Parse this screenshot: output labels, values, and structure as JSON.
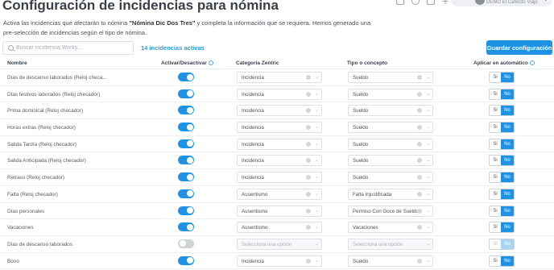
{
  "header": {
    "title": "Configuración de incidencias para nómina",
    "company": "DEMO El Cafecito Viajo"
  },
  "intro": {
    "before": "Activa las incidencias que afectarán tu nómina ",
    "payroll_name": "\"Nómina Dic Dos Tres\"",
    "after": " y completa la información que se requiera. Hemos generado una pre-selección de incidencias según el tipo de nómina."
  },
  "search": {
    "placeholder": "Buscar incidencia Worky..."
  },
  "active_count": "14 incidencias activas",
  "save_label": "Guardar configuración",
  "columns": {
    "name": "Nombre",
    "toggle": "Activar/Desactivar",
    "category": "Categoría Zentric",
    "type": "Tipo o concepto",
    "auto": "Aplicar en automático"
  },
  "rows": [
    {
      "name": "Días de descanso laborados (Reloj checa...",
      "active": true,
      "category": "Incidencia",
      "type": "Sueldo",
      "auto_yes": "Si",
      "auto_no": "No"
    },
    {
      "name": "Días festivos laborados (Reloj checador)",
      "active": true,
      "category": "Incidencia",
      "type": "Sueldo",
      "auto_yes": "Si",
      "auto_no": "No"
    },
    {
      "name": "Prima dominical (Reloj checador)",
      "active": true,
      "category": "Incidencia",
      "type": "Sueldo",
      "auto_yes": "Si",
      "auto_no": "No"
    },
    {
      "name": "Horas extras (Reloj checador)",
      "active": true,
      "category": "Incidencia",
      "type": "Sueldo",
      "auto_yes": "Si",
      "auto_no": "No"
    },
    {
      "name": "Salida Tardía (Reloj checador)",
      "active": true,
      "category": "Incidencia",
      "type": "Sueldo",
      "auto_yes": "Si",
      "auto_no": "No"
    },
    {
      "name": "Salida Anticipada (Reloj checador)",
      "active": true,
      "category": "Incidencia",
      "type": "Sueldo",
      "auto_yes": "Si",
      "auto_no": "No"
    },
    {
      "name": "Retraso (Reloj checador)",
      "active": true,
      "category": "Incidencia",
      "type": "Sueldo",
      "auto_yes": "Si",
      "auto_no": "No"
    },
    {
      "name": "Falta (Reloj checador)",
      "active": true,
      "category": "Ausentismo",
      "type": "Falta Injustificada",
      "auto_yes": "Si",
      "auto_no": "No"
    },
    {
      "name": "Días personales",
      "active": true,
      "category": "Ausentismo",
      "type": "Permiso Con Goce de Sueldo",
      "auto_yes": "Si",
      "auto_no": "No"
    },
    {
      "name": "Vacaciones",
      "active": true,
      "category": "Ausentismo",
      "type": "Vacaciones",
      "auto_yes": "Si",
      "auto_no": "No"
    },
    {
      "name": "Días de descanso laborados",
      "active": false,
      "category": "Selecciona una opción",
      "type": "Selecciona una opción",
      "auto_yes": "Si",
      "auto_no": "No"
    },
    {
      "name": "Bono",
      "active": true,
      "category": "Incidencia",
      "type": "Sueldo",
      "auto_yes": "Si",
      "auto_no": "No"
    }
  ],
  "colors": {
    "accent": "#1e93e6",
    "link": "#2a9ad6",
    "toggle_off": "#cfd3d8"
  }
}
